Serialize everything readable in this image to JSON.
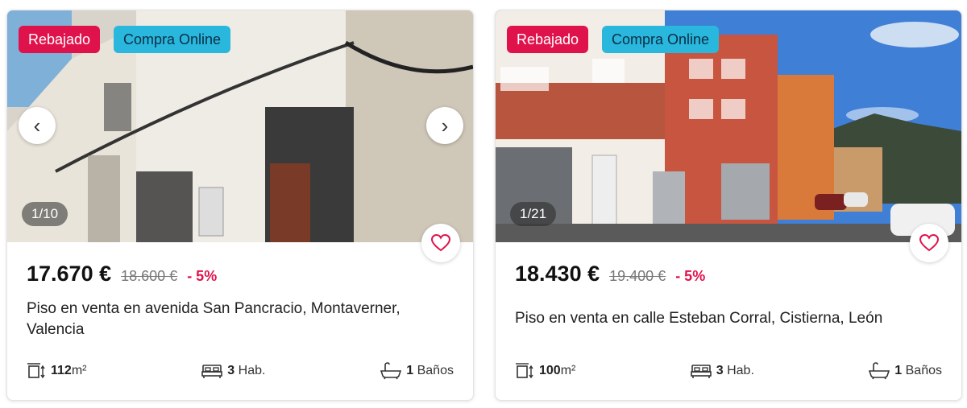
{
  "listings": [
    {
      "badges": {
        "sale": "Rebajado",
        "online": "Compra Online"
      },
      "counter": "1/10",
      "price": "17.670 €",
      "old_price": "18.600 €",
      "discount": "- 5%",
      "title": "Piso en venta en avenida San Pancracio, Montaverner, Valencia",
      "features": {
        "area_value": "112",
        "area_unit": "m²",
        "rooms_value": "3",
        "rooms_unit": "Hab.",
        "baths_value": "1",
        "baths_unit": "Baños"
      },
      "icons": {
        "prev": "chevron-left-icon",
        "next": "chevron-right-icon",
        "favorite": "heart-icon",
        "area": "area-icon",
        "rooms": "bed-icon",
        "baths": "bathtub-icon"
      }
    },
    {
      "badges": {
        "sale": "Rebajado",
        "online": "Compra Online"
      },
      "counter": "1/21",
      "price": "18.430 €",
      "old_price": "19.400 €",
      "discount": "- 5%",
      "title": "Piso en venta en calle Esteban Corral, Cistierna, León",
      "features": {
        "area_value": "100",
        "area_unit": "m²",
        "rooms_value": "3",
        "rooms_unit": "Hab.",
        "baths_value": "1",
        "baths_unit": "Baños"
      },
      "icons": {
        "favorite": "heart-icon",
        "area": "area-icon",
        "rooms": "bed-icon",
        "baths": "bathtub-icon"
      }
    }
  ],
  "colors": {
    "sale_badge": "#e0124c",
    "online_badge": "#2ab7dd",
    "discount": "#e0124c",
    "heart": "#e0124c"
  }
}
